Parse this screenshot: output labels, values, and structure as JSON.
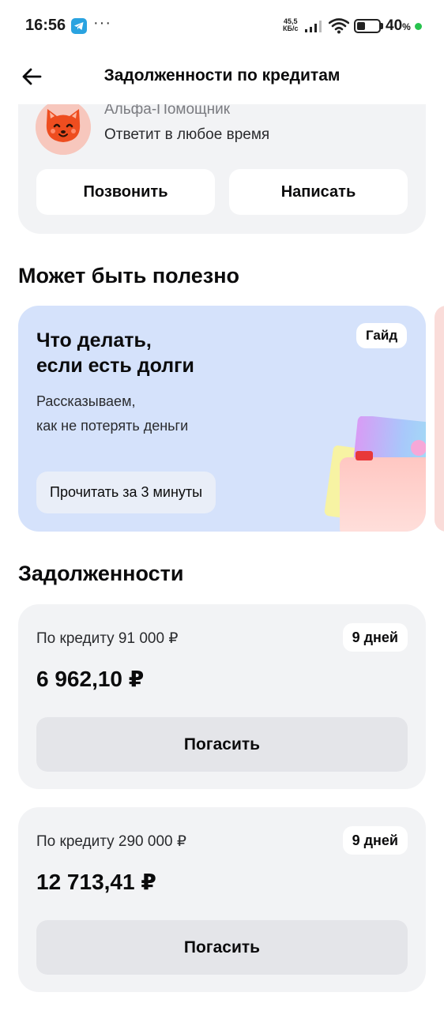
{
  "status_bar": {
    "time": "16:56",
    "speed_value": "45,5",
    "speed_unit": "КБ/с",
    "battery_percent": "40",
    "battery_unit": "%",
    "battery_level": 0.4,
    "icons": [
      "telegram-icon",
      "more-dots-icon",
      "signal-icon",
      "wifi-icon",
      "battery-icon"
    ]
  },
  "header": {
    "title": "Задолженности по кредитам",
    "back_icon": "arrow-left-icon"
  },
  "assistant": {
    "name": "Альфа-Помощник",
    "subtitle": "Ответит в любое время",
    "call_label": "Позвонить",
    "write_label": "Написать"
  },
  "useful": {
    "section_title": "Может быть полезно",
    "guide": {
      "title_line1": "Что делать,",
      "title_line2": "если есть долги",
      "badge": "Гайд",
      "text_line1": "Рассказываем,",
      "text_line2": "как не потерять деньги",
      "read_label": "Прочитать за 3 минуты"
    }
  },
  "debts": {
    "section_title": "Задолженности",
    "items": [
      {
        "label": "По кредиту 91 000 ₽",
        "days": "9 дней",
        "amount": "6 962,10 ₽",
        "pay_label": "Погасить"
      },
      {
        "label": "По кредиту 290 000 ₽",
        "days": "9 дней",
        "amount": "12 713,41 ₽",
        "pay_label": "Погасить"
      }
    ]
  },
  "colors": {
    "card_bg": "#f2f3f5",
    "guide_bg": "#d5e2fb",
    "button_bg": "#e4e5e9",
    "accent_green": "#27c34e"
  }
}
